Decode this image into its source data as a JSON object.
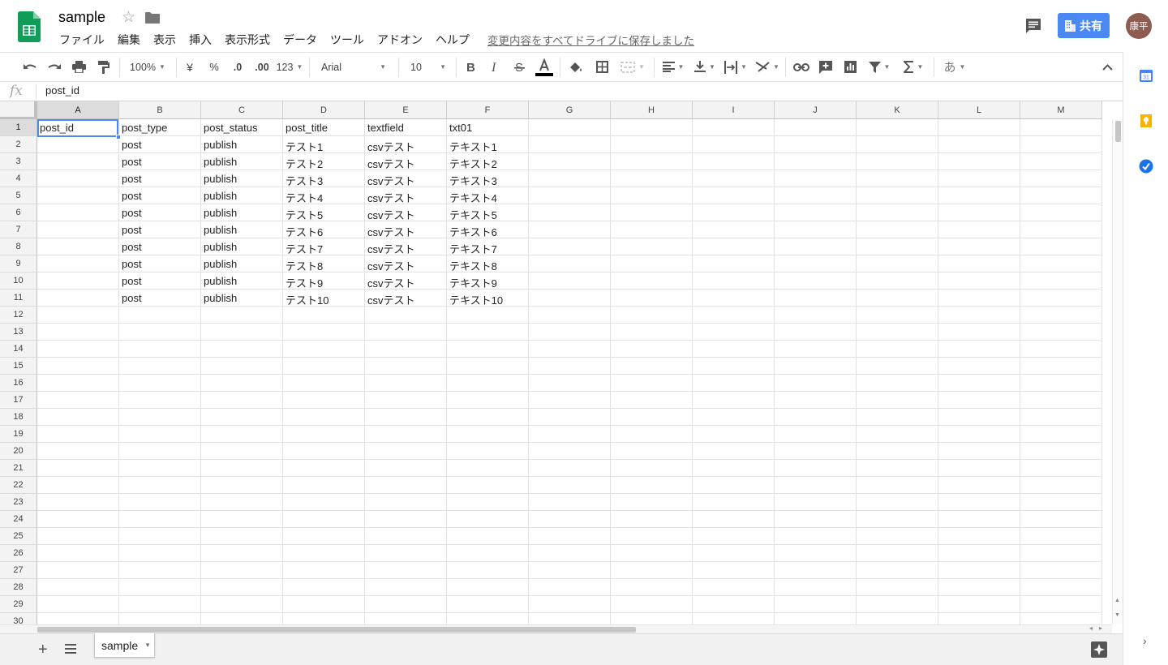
{
  "document": {
    "title": "sample",
    "save_status": "変更内容をすべてドライブに保存しました"
  },
  "menu": [
    "ファイル",
    "編集",
    "表示",
    "挿入",
    "表示形式",
    "データ",
    "ツール",
    "アドオン",
    "ヘルプ"
  ],
  "header": {
    "share_label": "共有",
    "avatar_text": "康平"
  },
  "toolbar": {
    "zoom": "100%",
    "currency": "¥",
    "percent": "%",
    "decrease_decimal": ".0",
    "increase_decimal": ".00",
    "more_formats": "123",
    "font": "Arial",
    "font_size": "10",
    "input_tools": "あ"
  },
  "formula_bar": {
    "fx": "fx",
    "value": "post_id"
  },
  "columns": [
    "A",
    "B",
    "C",
    "D",
    "E",
    "F",
    "G",
    "H",
    "I",
    "J",
    "K",
    "L",
    "M"
  ],
  "row_numbers": [
    "1",
    "2",
    "3",
    "4",
    "5",
    "6",
    "7",
    "8",
    "9",
    "10",
    "11",
    "12",
    "13",
    "14",
    "15",
    "16",
    "17",
    "18",
    "19",
    "20",
    "21",
    "22",
    "23",
    "24",
    "25",
    "26",
    "27",
    "28",
    "29",
    "30"
  ],
  "cells": [
    [
      "post_id",
      "post_type",
      "post_status",
      "post_title",
      "textfield",
      "txt01"
    ],
    [
      "",
      "post",
      "publish",
      "テスト1",
      "csvテスト",
      "テキスト1"
    ],
    [
      "",
      "post",
      "publish",
      "テスト2",
      "csvテスト",
      "テキスト2"
    ],
    [
      "",
      "post",
      "publish",
      "テスト3",
      "csvテスト",
      "テキスト3"
    ],
    [
      "",
      "post",
      "publish",
      "テスト4",
      "csvテスト",
      "テキスト4"
    ],
    [
      "",
      "post",
      "publish",
      "テスト5",
      "csvテスト",
      "テキスト5"
    ],
    [
      "",
      "post",
      "publish",
      "テスト6",
      "csvテスト",
      "テキスト6"
    ],
    [
      "",
      "post",
      "publish",
      "テスト7",
      "csvテスト",
      "テキスト7"
    ],
    [
      "",
      "post",
      "publish",
      "テスト8",
      "csvテスト",
      "テキスト8"
    ],
    [
      "",
      "post",
      "publish",
      "テスト9",
      "csvテスト",
      "テキスト9"
    ],
    [
      "",
      "post",
      "publish",
      "テスト10",
      "csvテスト",
      "テキスト10"
    ]
  ],
  "selected_cell": "A1",
  "sheets": [
    {
      "name": "sample",
      "active": true
    }
  ],
  "colors": {
    "brand_green": "#0f9d58",
    "share_blue": "#4a89f3",
    "selection_blue": "#4a89f3",
    "avatar_brown": "#8d5d52"
  }
}
